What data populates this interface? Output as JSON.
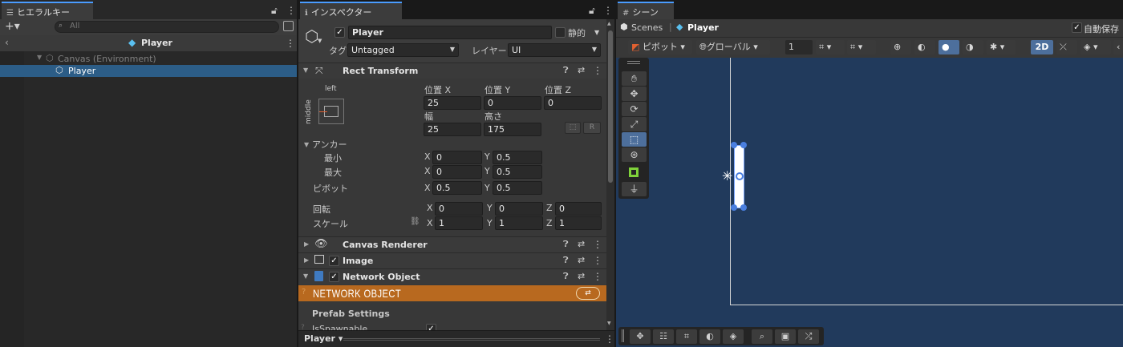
{
  "hierarchy": {
    "tab_label": "ヒエラルキー",
    "search_placeholder": "All",
    "scene_title": "Player",
    "items": [
      {
        "label": "Canvas (Environment)"
      },
      {
        "label": "Player"
      }
    ]
  },
  "inspector": {
    "tab_label": "インスペクター",
    "object_name": "Player",
    "static_label": "静的",
    "tag_label": "タグ",
    "tag_value": "Untagged",
    "layer_label": "レイヤー",
    "layer_value": "UI",
    "rect_transform": {
      "title": "Rect Transform",
      "anchor_h": "left",
      "anchor_v": "middle",
      "pos_x_label": "位置 X",
      "pos_y_label": "位置 Y",
      "pos_z_label": "位置 Z",
      "pos_x": "25",
      "pos_y": "0",
      "pos_z": "0",
      "width_label": "幅",
      "height_label": "高さ",
      "width": "25",
      "height": "175",
      "r_button": "R",
      "anchors_label": "アンカー",
      "min_label": "最小",
      "max_label": "最大",
      "pivot_label": "ピボット",
      "min_x": "0",
      "min_y": "0.5",
      "max_x": "0",
      "max_y": "0.5",
      "pivot_x": "0.5",
      "pivot_y": "0.5",
      "rotation_label": "回転",
      "scale_label": "スケール",
      "rot_x": "0",
      "rot_y": "0",
      "rot_z": "0",
      "scale_x": "1",
      "scale_y": "1",
      "scale_z": "1",
      "axis_x": "X",
      "axis_y": "Y",
      "axis_z": "Z"
    },
    "components": [
      {
        "name": "Canvas Renderer"
      },
      {
        "name": "Image"
      },
      {
        "name": "Network Object"
      }
    ],
    "network_banner": "NETWORK OBJECT",
    "prefab_settings": "Prefab Settings",
    "is_spawnable": "IsSpawnable",
    "footer_label": "Player"
  },
  "scene": {
    "tab_label": "シーン",
    "breadcrumb_root": "Scenes",
    "breadcrumb_current": "Player",
    "auto_save_label": "自動保存",
    "pivot_button": "ピボット",
    "global_button": "グローバル",
    "grid_value": "1",
    "mode_2d": "2D"
  },
  "colors": {
    "accent_blue": "#4a9cff",
    "selection": "#2c5d87",
    "scene_bg": "#213a5c",
    "network_banner": "#b8691f"
  }
}
